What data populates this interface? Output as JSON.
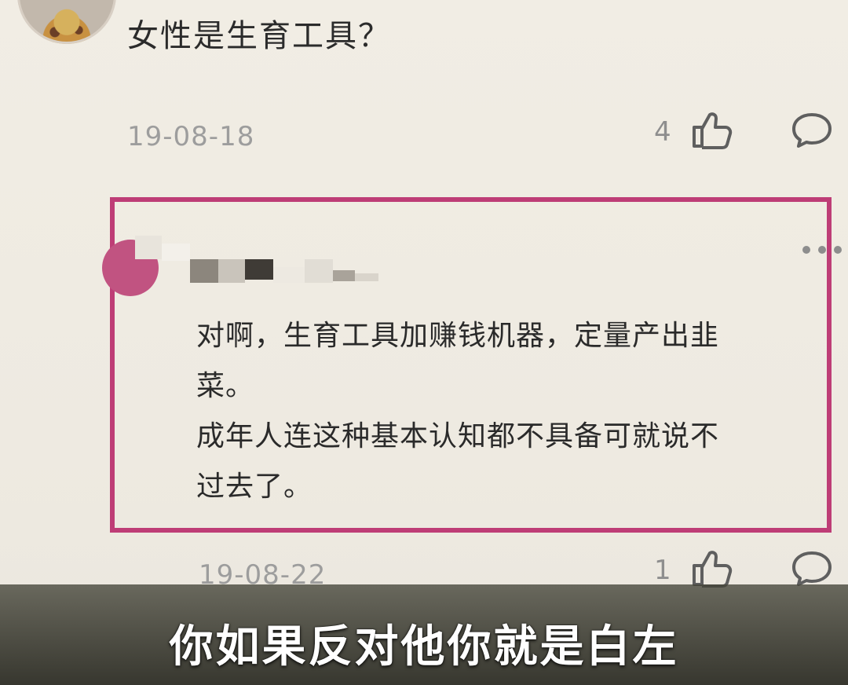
{
  "parent_comment": {
    "text": "女性是生育工具？",
    "date": "19-08-18",
    "like_count": "4",
    "like_icon": "thumbs-up-icon",
    "reply_icon": "comment-bubble-icon"
  },
  "highlighted_reply": {
    "border_color": "#be3d76",
    "avatar_color": "#c15381",
    "username_obscured": true,
    "more_icon": "more-dots-icon",
    "lines": [
      "对啊，生育工具加赚钱机器，定量产出韭",
      "菜。",
      "成年人连这种基本认知都不具备可就说不",
      "过去了。"
    ],
    "date": "19-08-22",
    "like_count": "1",
    "like_icon": "thumbs-up-icon",
    "reply_icon": "comment-bubble-icon"
  },
  "subtitle": {
    "text": "你如果反对他你就是白左"
  }
}
